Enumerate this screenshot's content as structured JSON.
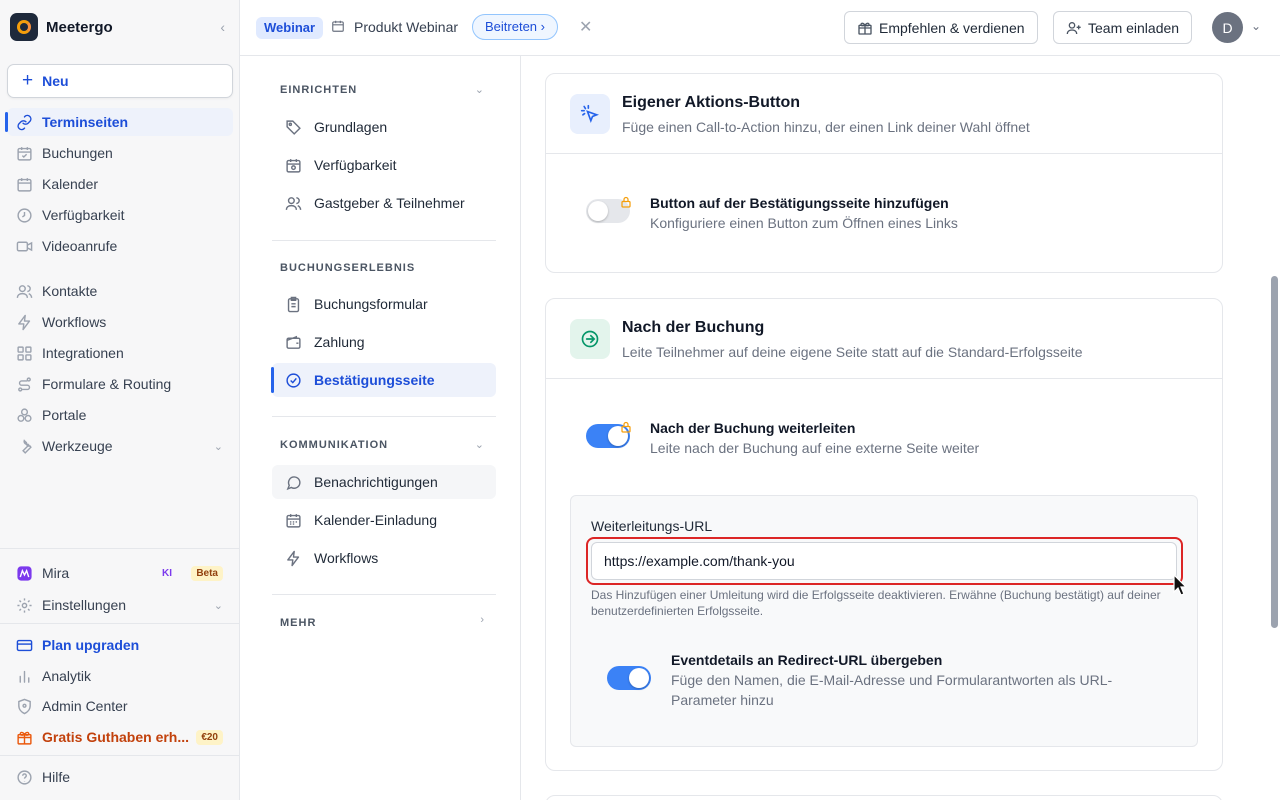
{
  "sidebar": {
    "brand": "Meetergo",
    "new_label": "Neu",
    "items": [
      {
        "label": "Terminseiten"
      },
      {
        "label": "Buchungen"
      },
      {
        "label": "Kalender"
      },
      {
        "label": "Verfügbarkeit"
      },
      {
        "label": "Videoanrufe"
      },
      {
        "label": "Kontakte"
      },
      {
        "label": "Workflows"
      },
      {
        "label": "Integrationen"
      },
      {
        "label": "Formulare & Routing"
      },
      {
        "label": "Portale"
      },
      {
        "label": "Werkzeuge"
      }
    ],
    "bottom": {
      "mira": "Mira",
      "mira_ki": "KI",
      "mira_beta": "Beta",
      "settings": "Einstellungen",
      "upgrade": "Plan upgraden",
      "analytics": "Analytik",
      "admin": "Admin Center",
      "credit": "Gratis Guthaben erh...",
      "credit_badge": "€20",
      "help": "Hilfe"
    }
  },
  "topbar": {
    "tag": "Webinar",
    "title": "Produkt Webinar",
    "join_label": "Beitreten",
    "refer_label": "Empfehlen & verdienen",
    "invite_label": "Team einladen",
    "avatar_initial": "D"
  },
  "secnav": {
    "setup_heading": "EINRICHTEN",
    "setup_items": [
      "Grundlagen",
      "Verfügbarkeit",
      "Gastgeber & Teilnehmer"
    ],
    "booking_heading": "BUCHUNGSERLEBNIS",
    "booking_items": [
      "Buchungsformular",
      "Zahlung",
      "Bestätigungsseite"
    ],
    "comm_heading": "KOMMUNIKATION",
    "comm_items": [
      "Benachrichtigungen",
      "Kalender-Einladung",
      "Workflows"
    ],
    "more_heading": "MEHR"
  },
  "cards": {
    "action": {
      "title": "Eigener Aktions-Button",
      "subtitle": "Füge einen Call-to-Action hinzu, der einen Link deiner Wahl öffnet",
      "toggle_title": "Button auf der Bestätigungsseite hinzufügen",
      "toggle_sub": "Konfiguriere einen Button zum Öffnen eines Links",
      "toggle_on": false
    },
    "after": {
      "title": "Nach der Buchung",
      "subtitle": "Leite Teilnehmer auf deine eigene Seite statt auf die Standard-Erfolgsseite",
      "toggle_title": "Nach der Buchung weiterleiten",
      "toggle_sub": "Leite nach der Buchung auf eine externe Seite weiter",
      "toggle_on": true,
      "url_label": "Weiterleitungs-URL",
      "url_value": "https://example.com/thank-you",
      "url_help": "Das Hinzufügen einer Umleitung wird die Erfolgsseite deaktivieren. Erwähne (Buchung bestätigt) auf deiner benutzerdefinierten Erfolgsseite.",
      "pass_title": "Eventdetails an Redirect-URL übergeben",
      "pass_sub": "Füge den Namen, die E-Mail-Adresse und Formularantworten als URL-Parameter hinzu",
      "pass_on": true
    }
  },
  "colors": {
    "accent": "#2563eb",
    "active_bg": "#eef2fb",
    "highlight": "#dc2626",
    "lock": "#f59e0b"
  }
}
